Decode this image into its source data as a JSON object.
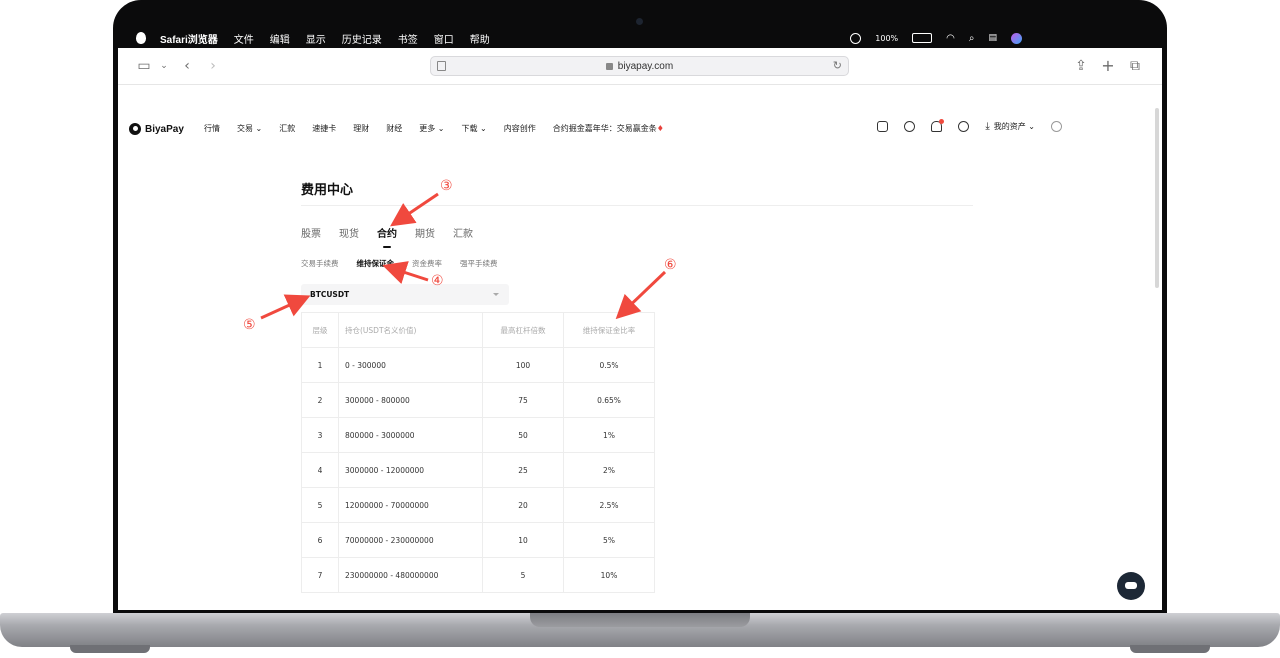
{
  "menubar": {
    "app": "Safari浏览器",
    "items": [
      "文件",
      "编辑",
      "显示",
      "历史记录",
      "书签",
      "窗口",
      "帮助"
    ],
    "battery": "100%"
  },
  "browser": {
    "url": "biyapay.com"
  },
  "site": {
    "logo": "BiyaPay",
    "nav": [
      "行情",
      "交易",
      "汇款",
      "速捷卡",
      "理财",
      "财经",
      "更多",
      "下载",
      "内容创作"
    ],
    "promo": "合约掘金嘉年华：交易赢金条",
    "my_assets": "我的资产"
  },
  "page": {
    "title": "费用中心",
    "tabs": [
      {
        "label": "股票",
        "active": false
      },
      {
        "label": "现货",
        "active": false
      },
      {
        "label": "合约",
        "active": true
      },
      {
        "label": "期货",
        "active": false
      },
      {
        "label": "汇款",
        "active": false
      }
    ],
    "subtabs": [
      {
        "label": "交易手续费",
        "active": false
      },
      {
        "label": "维持保证金",
        "active": true
      },
      {
        "label": "资金费率",
        "active": false
      },
      {
        "label": "强平手续费",
        "active": false
      }
    ],
    "symbol": "BTCUSDT",
    "table": {
      "headers": [
        "层级",
        "持仓(USDT名义价值)",
        "最高杠杆倍数",
        "维持保证金比率"
      ],
      "rows": [
        [
          "1",
          "0 - 300000",
          "100",
          "0.5%"
        ],
        [
          "2",
          "300000 - 800000",
          "75",
          "0.65%"
        ],
        [
          "3",
          "800000 - 3000000",
          "50",
          "1%"
        ],
        [
          "4",
          "3000000 - 12000000",
          "25",
          "2%"
        ],
        [
          "5",
          "12000000 - 70000000",
          "20",
          "2.5%"
        ],
        [
          "6",
          "70000000 - 230000000",
          "10",
          "5%"
        ],
        [
          "7",
          "230000000 - 480000000",
          "5",
          "10%"
        ]
      ]
    }
  },
  "annotations": [
    "③",
    "④",
    "⑤",
    "⑥"
  ],
  "colors": {
    "accent": "#f0493e",
    "notification": "#f04a3e",
    "fab": "#1d2836"
  }
}
